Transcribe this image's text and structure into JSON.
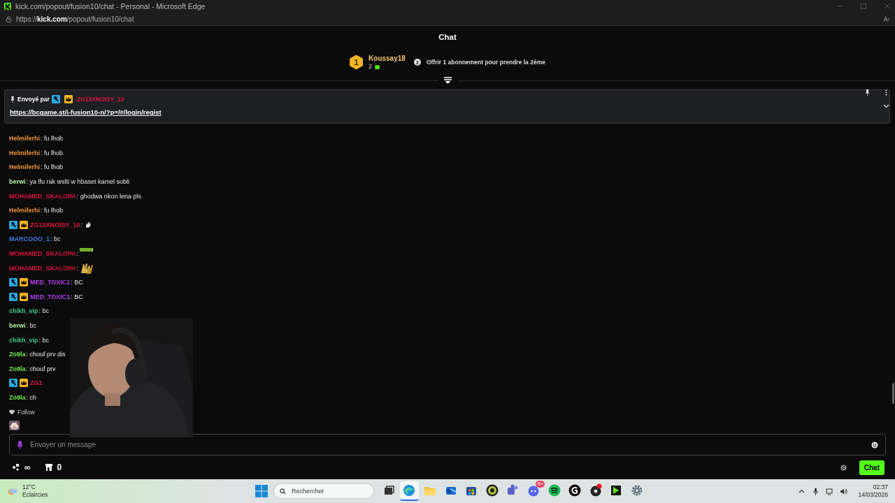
{
  "window": {
    "title": "kick.com/popout/fusion10/chat - Personal - Microsoft Edge"
  },
  "address_bar": {
    "scheme": "https://",
    "domain": "kick.com",
    "path": "/popout/fusion10/chat"
  },
  "header": {
    "title": "Chat"
  },
  "leaderboard": {
    "rank": "1",
    "user": "Koussay18",
    "count": "2",
    "offer_count": "2",
    "offer": "Offrir 1 abonnement pour prendre la 2ème"
  },
  "pinned": {
    "label": "Envoyé par",
    "badges": [
      {
        "kind": "hammer"
      },
      {
        "kind": "crown"
      }
    ],
    "user": "ZG13XNOISY_10",
    "link": "https://bcgame.st/i-fusion10-n/?p=/#/login/regist"
  },
  "messages": [
    {
      "user": "Helmiferhi",
      "color": "#f0923a",
      "text": ": fu lhob"
    },
    {
      "user": "Helmiferhi",
      "color": "#f0923a",
      "text": ": fu lhob"
    },
    {
      "user": "Helmiferhi",
      "color": "#f0923a",
      "text": ": fu lhob"
    },
    {
      "user": "berwi",
      "color": "#b4f0a0",
      "text": ": ya lfu rak wslti w hbaset kamel sobli"
    },
    {
      "user": "MOHAMED_SKALOPA",
      "color": "#d8143e",
      "text": ": ghodwa nkon lena pls"
    },
    {
      "user": "Helmiferhi",
      "color": "#f0923a",
      "text": ": fu lhob"
    },
    {
      "user": "ZG13XNOISY_10",
      "color": "#e0163e",
      "badges": [
        {
          "kind": "hammer"
        },
        {
          "kind": "crown"
        }
      ],
      "text": ":",
      "emote": {
        "kind": "hand"
      }
    },
    {
      "user": "MARCOOO_1",
      "color": "#3a7be0",
      "text": ": bc"
    },
    {
      "user": "MOHAMED_SKALOPA",
      "color": "#d8143e",
      "text": ":",
      "emote": {
        "kind": "bar"
      }
    },
    {
      "user": "MOHAMED_SKALOPA",
      "color": "#d8143e",
      "text": ":",
      "emote": {
        "kind": "gold"
      }
    },
    {
      "user": "MED_TOXIC1",
      "color": "#b13ff0",
      "badges": [
        {
          "kind": "hammer"
        },
        {
          "kind": "crown"
        }
      ],
      "text": ": BC"
    },
    {
      "user": "MED_TOXIC1",
      "color": "#b13ff0",
      "badges": [
        {
          "kind": "hammer"
        },
        {
          "kind": "crown"
        }
      ],
      "text": ": BC"
    },
    {
      "user": "chikh_vip",
      "color": "#3ec98a",
      "text": ": bc"
    },
    {
      "user": "berwi",
      "color": "#b4f0a0",
      "text": ": bc"
    },
    {
      "user": "chikh_vip",
      "color": "#3ec98a",
      "text": ": bc"
    },
    {
      "user": "Zo9la",
      "color": "#6fe84a",
      "text": ": chouf prv dis"
    },
    {
      "user": "Zo9la",
      "color": "#6fe84a",
      "text": ": chouf prv"
    },
    {
      "user": "ZG1",
      "color": "#e0163e",
      "badges": [
        {
          "kind": "hammer"
        },
        {
          "kind": "crown"
        }
      ]
    },
    {
      "user": "Zo9la",
      "color": "#6fe84a",
      "text": ": ch"
    }
  ],
  "follow": {
    "label": "Follow"
  },
  "composer": {
    "placeholder": "Envoyer un message"
  },
  "footer": {
    "points": "∞",
    "store_count": "0",
    "chat_button": "Chat"
  },
  "taskbar": {
    "weather": {
      "temp": "12°C",
      "condition": "Eclaircies"
    },
    "search": {
      "placeholder": "Rechercher"
    },
    "apps": [
      {
        "kind": "taskview",
        "selected": false
      },
      {
        "kind": "browser",
        "selected": true
      },
      {
        "kind": "folder",
        "selected": false
      },
      {
        "kind": "mail",
        "selected": false
      },
      {
        "kind": "store",
        "selected": false
      },
      {
        "kind": "disc",
        "selected": false
      },
      {
        "kind": "people",
        "selected": false
      },
      {
        "kind": "bubble",
        "selected": false,
        "badge": "9+"
      },
      {
        "kind": "music",
        "selected": false
      },
      {
        "kind": "letter",
        "selected": false
      },
      {
        "kind": "record",
        "selected": false
      },
      {
        "kind": "play",
        "selected": false
      },
      {
        "kind": "gear",
        "selected": false
      }
    ],
    "time": "02:37",
    "date": "14/03/2026"
  }
}
